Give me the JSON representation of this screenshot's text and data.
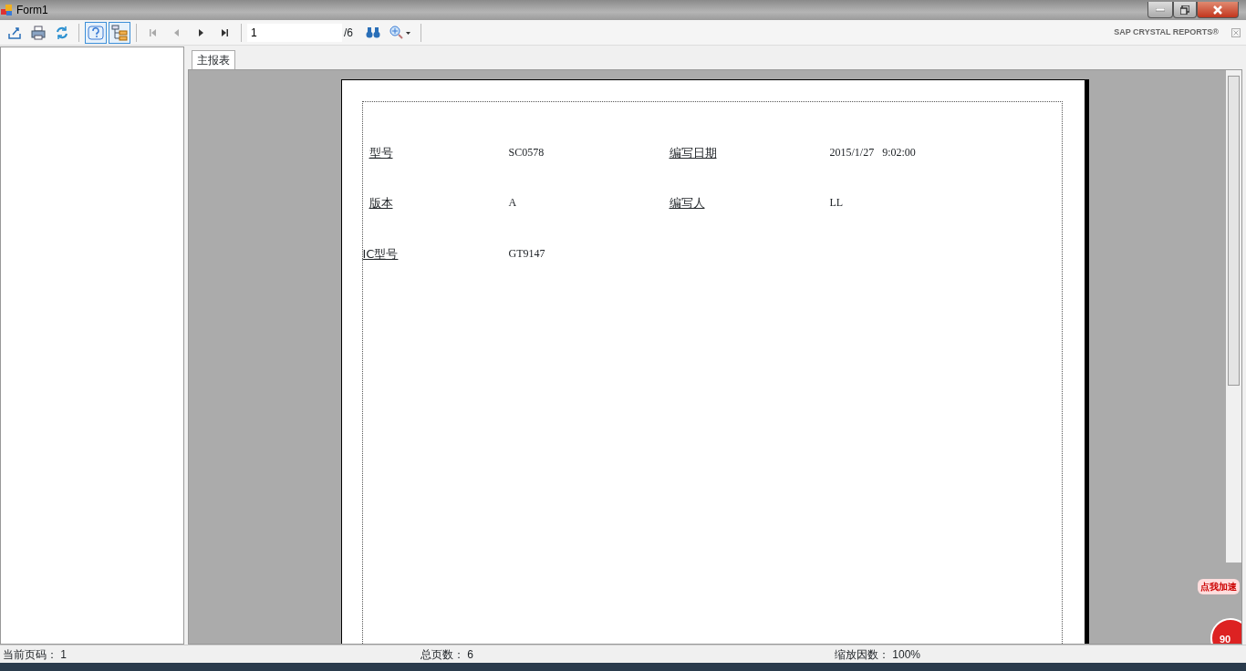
{
  "window": {
    "title": "Form1"
  },
  "toolbar": {
    "tools": [
      {
        "kind": "export",
        "on": false
      },
      {
        "kind": "print",
        "on": false
      },
      {
        "kind": "refresh",
        "on": false
      },
      {
        "kind": "help",
        "on": true
      },
      {
        "kind": "tree",
        "on": true
      }
    ],
    "nav": [
      {
        "kind": "first",
        "disabled": true
      },
      {
        "kind": "prev",
        "disabled": true
      },
      {
        "kind": "next",
        "disabled": false
      },
      {
        "kind": "last",
        "disabled": false
      }
    ],
    "page_input": "1",
    "page_total": "/6",
    "brand": "SAP CRYSTAL REPORTS®"
  },
  "tabs": [
    {
      "label": "主报表",
      "selected": true
    }
  ],
  "report": {
    "rows": [
      {
        "label": "型号",
        "value": "SC0578",
        "label_2": "编写日期",
        "value_2": "2015/1/27   9:02:00"
      },
      {
        "label": "版本",
        "value": "A",
        "label_2": "编写人",
        "value_2": "LL"
      },
      {
        "label": "IC型号",
        "value": "GT9147"
      }
    ]
  },
  "status_bar": [
    "当前页码： 1",
    "总页数： 6",
    "缩放因数： 100%"
  ],
  "widget": {
    "bubble": "点我加速",
    "score": "90"
  }
}
